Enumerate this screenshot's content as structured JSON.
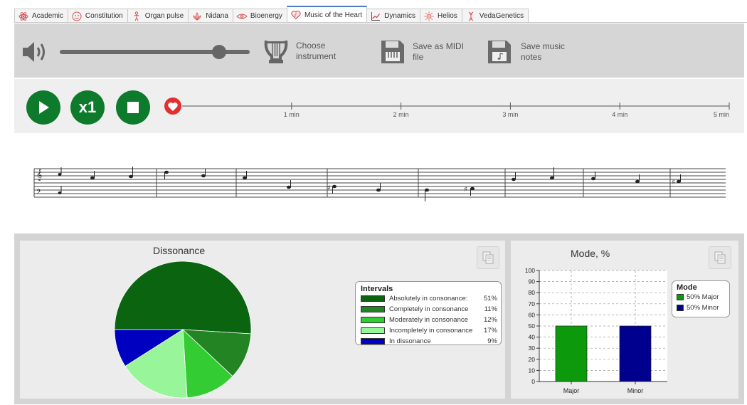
{
  "tabs": [
    {
      "label": "Academic",
      "icon": "atom-icon",
      "active": false
    },
    {
      "label": "Constitution",
      "icon": "face-icon",
      "active": false
    },
    {
      "label": "Organ pulse",
      "icon": "body-icon",
      "active": false
    },
    {
      "label": "Nidana",
      "icon": "lotus-icon",
      "active": false
    },
    {
      "label": "Bioenergy",
      "icon": "eye-icon",
      "active": false
    },
    {
      "label": "Music of the Heart",
      "icon": "heart-icon",
      "active": true
    },
    {
      "label": "Dynamics",
      "icon": "line-chart-icon",
      "active": false
    },
    {
      "label": "Helios",
      "icon": "sun-icon",
      "active": false
    },
    {
      "label": "VedaGenetics",
      "icon": "dna-icon",
      "active": false
    }
  ],
  "toolbar": {
    "volume_level": 0.84,
    "choose_instrument": [
      "Choose",
      "instrument"
    ],
    "save_midi": [
      "Save as MIDI",
      "file"
    ],
    "save_notes": [
      "Save music",
      "notes"
    ]
  },
  "player": {
    "play_icon": "play-icon",
    "speed_label": "x1",
    "stop_icon": "stop-icon",
    "marker_icon": "heart-icon",
    "timeline_labels": [
      "1 min",
      "2 min",
      "3 min",
      "4 min",
      "5 min"
    ]
  },
  "dissonance": {
    "title": "Dissonance",
    "legend_title": "Intervals",
    "items": [
      {
        "label": "Absolutely in consonance:",
        "value": "51%",
        "pct": 51,
        "color": "#0b6410"
      },
      {
        "label": "Completely in consonance",
        "value": "11%",
        "pct": 11,
        "color": "#238423"
      },
      {
        "label": "Moderately in consonance",
        "value": "12%",
        "pct": 12,
        "color": "#33cc33"
      },
      {
        "label": "Incompletely in consonance",
        "value": "17%",
        "pct": 17,
        "color": "#99f599"
      },
      {
        "label": "In dissonance",
        "value": "9%",
        "pct": 9,
        "color": "#0000c0"
      }
    ]
  },
  "mode": {
    "title": "Mode, %",
    "legend_title": "Mode",
    "legend": [
      "50% Major",
      "50% Minor"
    ],
    "categories": [
      "Major",
      "Minor"
    ],
    "values": [
      50,
      50
    ],
    "colors": [
      "#0c9a0c",
      "#00008f"
    ],
    "y_ticks": [
      "0",
      "10",
      "20",
      "30",
      "40",
      "50",
      "60",
      "70",
      "80",
      "90",
      "100"
    ]
  },
  "chart_data": [
    {
      "type": "pie",
      "title": "Dissonance",
      "legend_title": "Intervals",
      "labels": [
        "Absolutely in consonance:",
        "Completely in consonance",
        "Moderately in consonance",
        "Incompletely in consonance",
        "In dissonance"
      ],
      "values": [
        51,
        11,
        12,
        17,
        9
      ]
    },
    {
      "type": "bar",
      "title": "Mode, %",
      "categories": [
        "Major",
        "Minor"
      ],
      "values": [
        50,
        50
      ],
      "ylim": [
        0,
        100
      ],
      "grid": true,
      "legend": "right"
    }
  ]
}
